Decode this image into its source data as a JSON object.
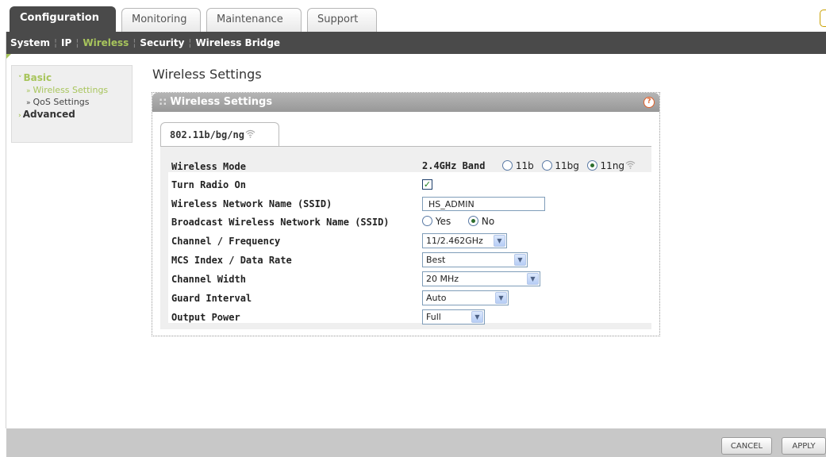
{
  "top_tabs": [
    "Configuration",
    "Monitoring",
    "Maintenance",
    "Support"
  ],
  "sub_nav": {
    "items": [
      "System",
      "IP",
      "Wireless",
      "Security",
      "Wireless Bridge"
    ]
  },
  "left_nav": {
    "basic": "Basic",
    "basic_items": [
      "Wireless Settings",
      "QoS Settings"
    ],
    "advanced": "Advanced"
  },
  "page_title": "Wireless Settings",
  "panel": {
    "title": "Wireless Settings",
    "tab": "802.11b/bg/ng"
  },
  "form": {
    "wireless_mode": {
      "label": "Wireless Mode",
      "band": "2.4GHz Band",
      "options": [
        "11b",
        "11bg",
        "11ng"
      ],
      "selected": "11ng"
    },
    "turn_radio_on": {
      "label": "Turn Radio On",
      "checked": true
    },
    "ssid": {
      "label": "Wireless Network Name (SSID)",
      "value": "HS_ADMIN"
    },
    "broadcast": {
      "label": "Broadcast Wireless Network Name (SSID)",
      "options": [
        "Yes",
        "No"
      ],
      "selected": "No"
    },
    "channel": {
      "label": "Channel / Frequency",
      "value": "11/2.462GHz"
    },
    "mcs": {
      "label": "MCS Index / Data Rate",
      "value": "Best"
    },
    "channel_width": {
      "label": "Channel Width",
      "value": "20 MHz"
    },
    "guard_interval": {
      "label": "Guard Interval",
      "value": "Auto"
    },
    "output_power": {
      "label": "Output Power",
      "value": "Full"
    }
  },
  "buttons": {
    "cancel": "CANCEL",
    "apply": "APPLY"
  },
  "colors": {
    "accent": "#a8c55c",
    "bar": "#4a4a4a",
    "panel_head": "#a6a6a6",
    "footer": "#c8c8c8"
  }
}
